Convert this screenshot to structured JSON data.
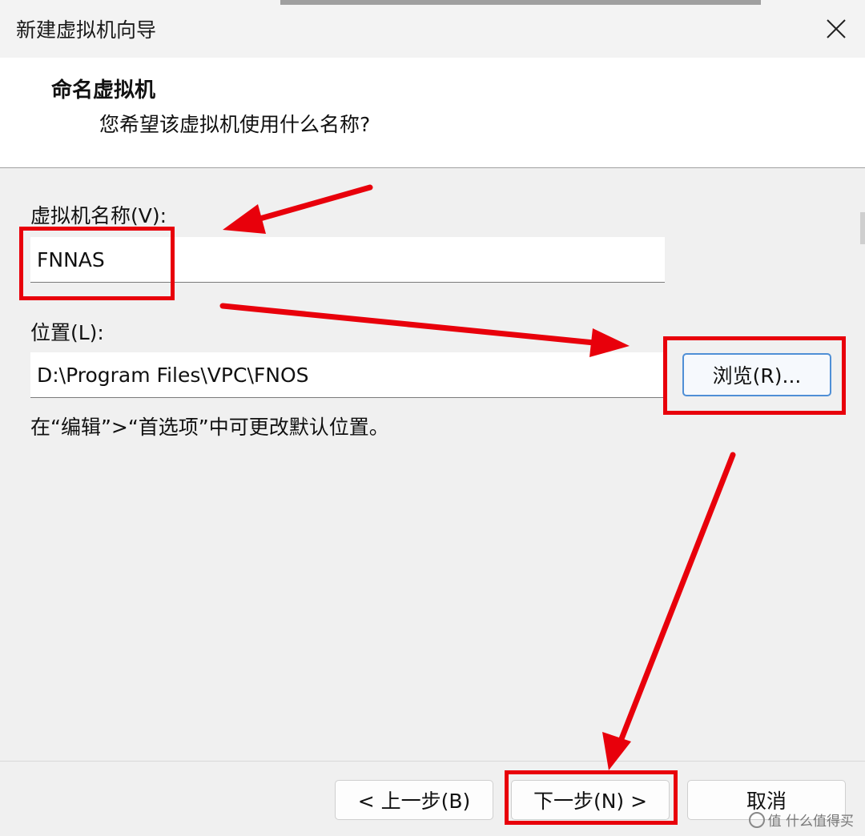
{
  "window": {
    "title": "新建虚拟机向导",
    "close_icon": "close-icon"
  },
  "header": {
    "title": "命名虚拟机",
    "subtitle": "您希望该虚拟机使用什么名称?"
  },
  "form": {
    "name_label": "虚拟机名称(V):",
    "name_value": "FNNAS",
    "location_label": "位置(L):",
    "location_value": "D:\\Program Files\\VPC\\FNOS",
    "browse_label": "浏览(R)...",
    "hint": "在“编辑”>“首选项”中可更改默认位置。"
  },
  "footer": {
    "back_label": "< 上一步(B)",
    "next_label": "下一步(N) >",
    "cancel_label": "取消"
  },
  "watermark": {
    "text": "值 什么值得买"
  },
  "colors": {
    "annotation_red": "#e8000b",
    "primary_border": "#4f8fd6"
  }
}
